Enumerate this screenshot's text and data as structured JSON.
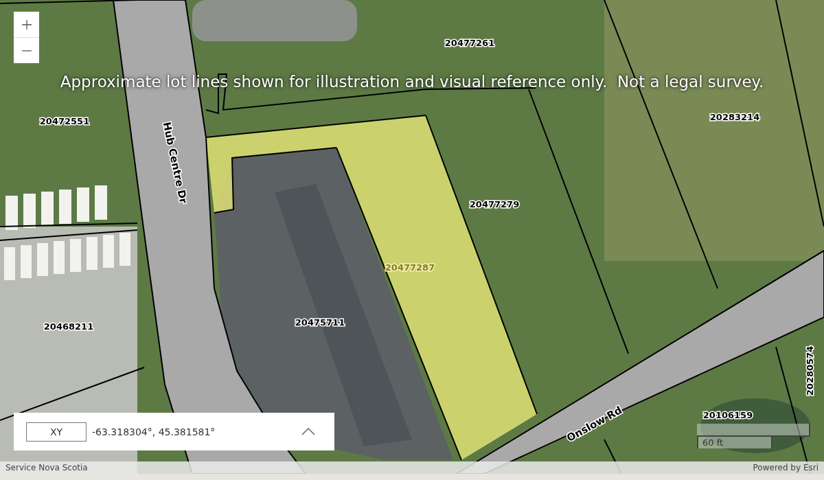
{
  "map": {
    "disclaimer": "Approximate lot lines shown for illustration and visual reference only.  Not a legal survey.",
    "roads": [
      {
        "name": "Hub Centre Dr"
      },
      {
        "name": "Onslow Rd"
      }
    ],
    "parcels": [
      {
        "number": "20477261",
        "selected": false
      },
      {
        "number": "20472551",
        "selected": false
      },
      {
        "number": "20283214",
        "selected": false
      },
      {
        "number": "20477279",
        "selected": false
      },
      {
        "number": "20477287",
        "selected": true
      },
      {
        "number": "20468211",
        "selected": false
      },
      {
        "number": "20475711",
        "selected": false
      },
      {
        "number": "20106159",
        "selected": false
      },
      {
        "number": "20280574",
        "selected": false
      }
    ],
    "scale": {
      "label": "60 ft"
    }
  },
  "coordinates": {
    "format": "XY",
    "value": "-63.318304°, 45.381581°"
  },
  "attribution": {
    "left": "Service Nova Scotia",
    "right": "Powered by Esri"
  }
}
